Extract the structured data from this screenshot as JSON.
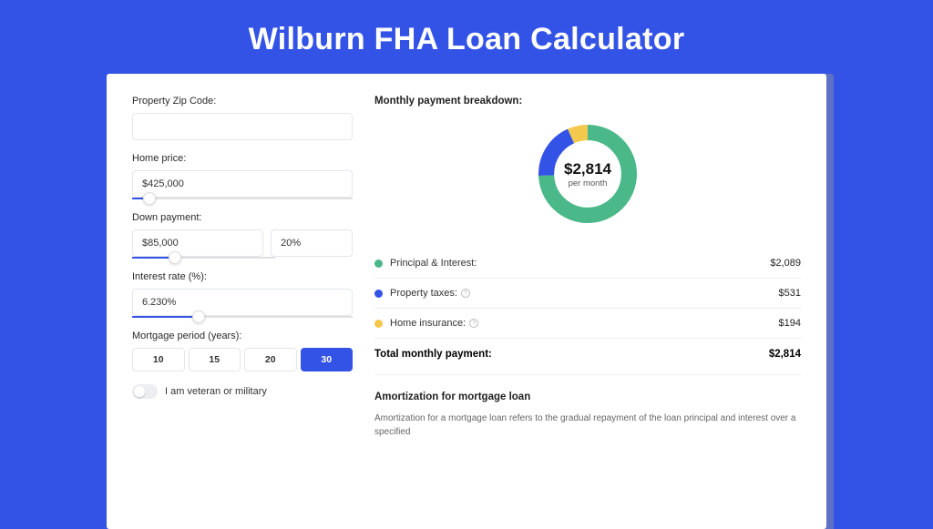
{
  "title": "Wilburn FHA Loan Calculator",
  "form": {
    "zip_label": "Property Zip Code:",
    "zip_value": "",
    "home_price_label": "Home price:",
    "home_price_value": "$425,000",
    "down_payment_label": "Down payment:",
    "down_payment_value": "$85,000",
    "down_payment_pct": "20%",
    "interest_rate_label": "Interest rate (%):",
    "interest_rate_value": "6.230%",
    "mortgage_period_label": "Mortgage period (years):",
    "periods": [
      "10",
      "15",
      "20",
      "30"
    ],
    "period_active_index": 3,
    "veteran_label": "I am veteran or military"
  },
  "breakdown": {
    "title": "Monthly payment breakdown:",
    "donut_value": "$2,814",
    "donut_sub": "per month",
    "items": [
      {
        "label": "Principal & Interest:",
        "value": "$2,089",
        "color": "#4ab889",
        "has_info": false
      },
      {
        "label": "Property taxes:",
        "value": "$531",
        "color": "#3253e6",
        "has_info": true
      },
      {
        "label": "Home insurance:",
        "value": "$194",
        "color": "#f2c94c",
        "has_info": true
      }
    ],
    "total_label": "Total monthly payment:",
    "total_value": "$2,814"
  },
  "amortization": {
    "title": "Amortization for mortgage loan",
    "text": "Amortization for a mortgage loan refers to the gradual repayment of the loan principal and interest over a specified"
  },
  "chart_data": {
    "type": "pie",
    "title": "Monthly payment breakdown",
    "series": [
      {
        "name": "Principal & Interest",
        "value": 2089,
        "color": "#4ab889"
      },
      {
        "name": "Property taxes",
        "value": 531,
        "color": "#3253e6"
      },
      {
        "name": "Home insurance",
        "value": 194,
        "color": "#f2c94c"
      }
    ],
    "total": 2814,
    "center_label": "$2,814 per month"
  }
}
